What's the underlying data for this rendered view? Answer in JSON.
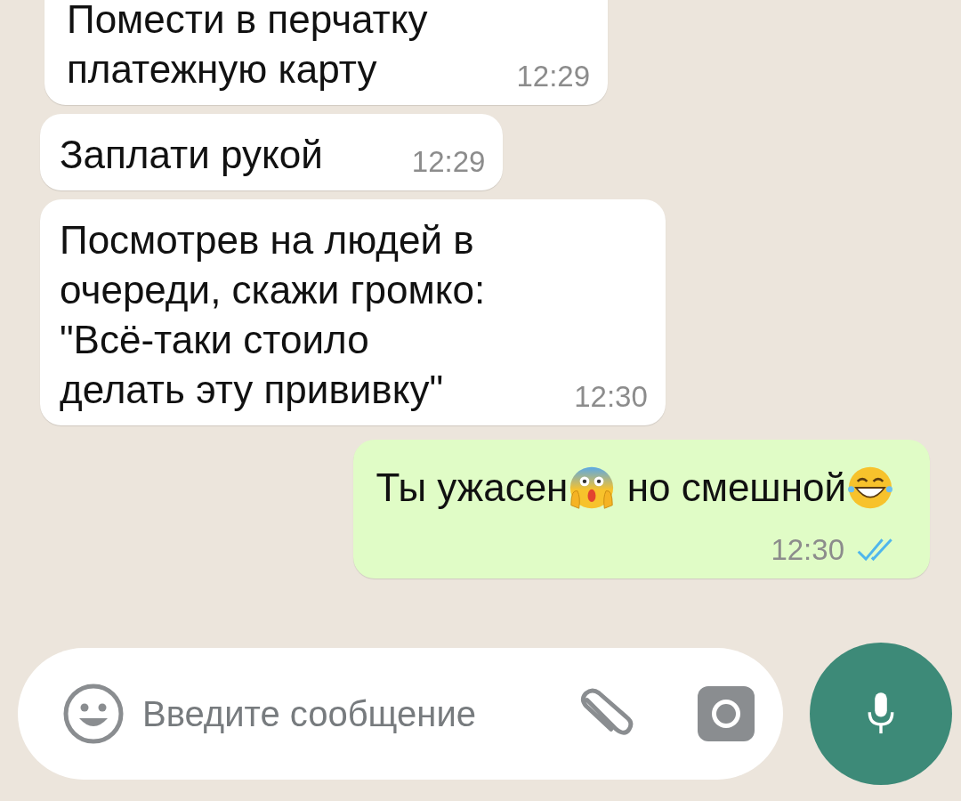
{
  "messages": [
    {
      "kind": "incoming",
      "text": "Помести в перчатку\nплатежную карту",
      "time": "12:29"
    },
    {
      "kind": "incoming",
      "text": "Заплати рукой",
      "time": "12:29"
    },
    {
      "kind": "incoming",
      "text": "Посмотрев на людей в\nочереди, скажи громко:\n\"Всё-таки стоило\nделать эту прививку\"",
      "time": "12:30"
    },
    {
      "kind": "outgoing",
      "parts": [
        {
          "kind": "text",
          "text": "Ты ужасен"
        },
        {
          "kind": "scream"
        },
        {
          "kind": "text",
          "text": " но смешной"
        },
        {
          "kind": "laugh"
        }
      ],
      "time": "12:30",
      "read": true
    }
  ],
  "composer": {
    "placeholder": "Введите сообщение"
  }
}
